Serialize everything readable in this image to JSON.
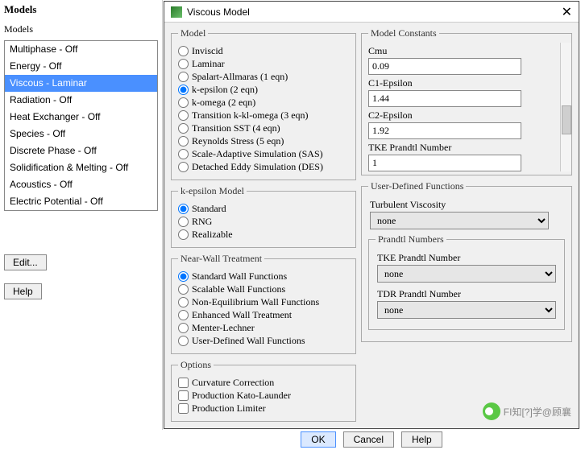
{
  "models_panel": {
    "title": "Models",
    "subtitle": "Models",
    "items": [
      "Multiphase - Off",
      "Energy - Off",
      "Viscous - Laminar",
      "Radiation - Off",
      "Heat Exchanger - Off",
      "Species - Off",
      "Discrete Phase - Off",
      "Solidification & Melting - Off",
      "Acoustics - Off",
      "Electric Potential - Off"
    ],
    "selected_index": 2,
    "edit_button": "Edit...",
    "help_button": "Help"
  },
  "dialog": {
    "title": "Viscous Model",
    "groups": {
      "model": {
        "legend": "Model",
        "options": [
          "Inviscid",
          "Laminar",
          "Spalart-Allmaras (1 eqn)",
          "k-epsilon (2 eqn)",
          "k-omega (2 eqn)",
          "Transition k-kl-omega (3 eqn)",
          "Transition SST (4 eqn)",
          "Reynolds Stress (5 eqn)",
          "Scale-Adaptive Simulation (SAS)",
          "Detached Eddy Simulation (DES)"
        ],
        "selected": 3
      },
      "ke_model": {
        "legend": "k-epsilon Model",
        "options": [
          "Standard",
          "RNG",
          "Realizable"
        ],
        "selected": 0
      },
      "near_wall": {
        "legend": "Near-Wall Treatment",
        "options": [
          "Standard Wall Functions",
          "Scalable Wall Functions",
          "Non-Equilibrium Wall Functions",
          "Enhanced Wall Treatment",
          "Menter-Lechner",
          "User-Defined Wall Functions"
        ],
        "selected": 0
      },
      "options_group": {
        "legend": "Options",
        "options": [
          "Curvature Correction",
          "Production Kato-Launder",
          "Production Limiter"
        ]
      },
      "constants": {
        "legend": "Model Constants",
        "items": [
          {
            "label": "Cmu",
            "value": "0.09"
          },
          {
            "label": "C1-Epsilon",
            "value": "1.44"
          },
          {
            "label": "C2-Epsilon",
            "value": "1.92"
          },
          {
            "label": "TKE Prandtl Number",
            "value": "1"
          }
        ]
      },
      "udf": {
        "legend": "User-Defined Functions",
        "turb_visc_label": "Turbulent Viscosity",
        "turb_visc_value": "none",
        "prandtl_legend": "Prandtl Numbers",
        "tke_label": "TKE Prandtl Number",
        "tke_value": "none",
        "tdr_label": "TDR Prandtl Number",
        "tdr_value": "none"
      }
    },
    "buttons": {
      "ok": "OK",
      "cancel": "Cancel",
      "help": "Help"
    }
  },
  "watermark": "FI知[?]学@顾襄"
}
